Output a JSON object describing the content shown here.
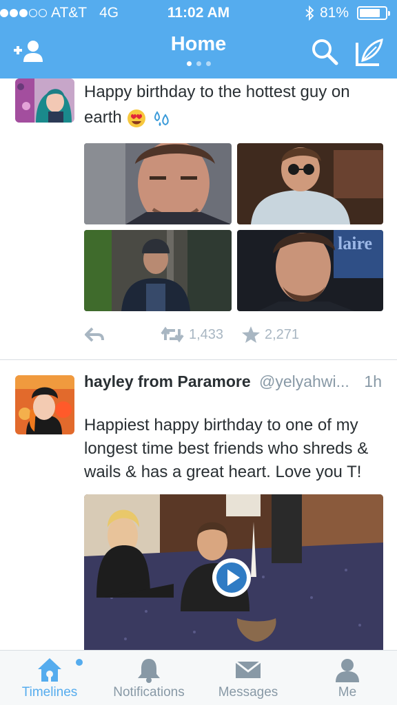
{
  "status_bar": {
    "carrier": "AT&T",
    "network": "4G",
    "time": "11:02 AM",
    "battery": "81%",
    "battery_level": 0.81,
    "signal_bars_filled": 3,
    "signal_bars_total": 5
  },
  "nav": {
    "title": "Home",
    "page_count": 3,
    "active_page": 1
  },
  "tweets": [
    {
      "text_line1": "Happy birthday to the hottest guy on",
      "text_line2": "earth",
      "emojis": [
        "heart-eyes-emoji",
        "sweat-droplets-emoji"
      ],
      "retweets": "1,433",
      "favorites": "2,271"
    },
    {
      "name": "hayley from Paramore",
      "handle": "@yelyahwi...",
      "time": "1h",
      "text": "Happiest happy birthday to one of my longest time best friends who shreds & wails & has a great heart. Love you T!"
    }
  ],
  "tabbar": {
    "items": [
      {
        "label": "Timelines",
        "icon": "home-icon",
        "active": true
      },
      {
        "label": "Notifications",
        "icon": "bell-icon",
        "active": false
      },
      {
        "label": "Messages",
        "icon": "envelope-icon",
        "active": false
      },
      {
        "label": "Me",
        "icon": "person-icon",
        "active": false
      }
    ]
  },
  "colors": {
    "brand": "#55acee",
    "text": "#292f33",
    "muted": "#8899a6",
    "action": "#a8b6c2"
  }
}
